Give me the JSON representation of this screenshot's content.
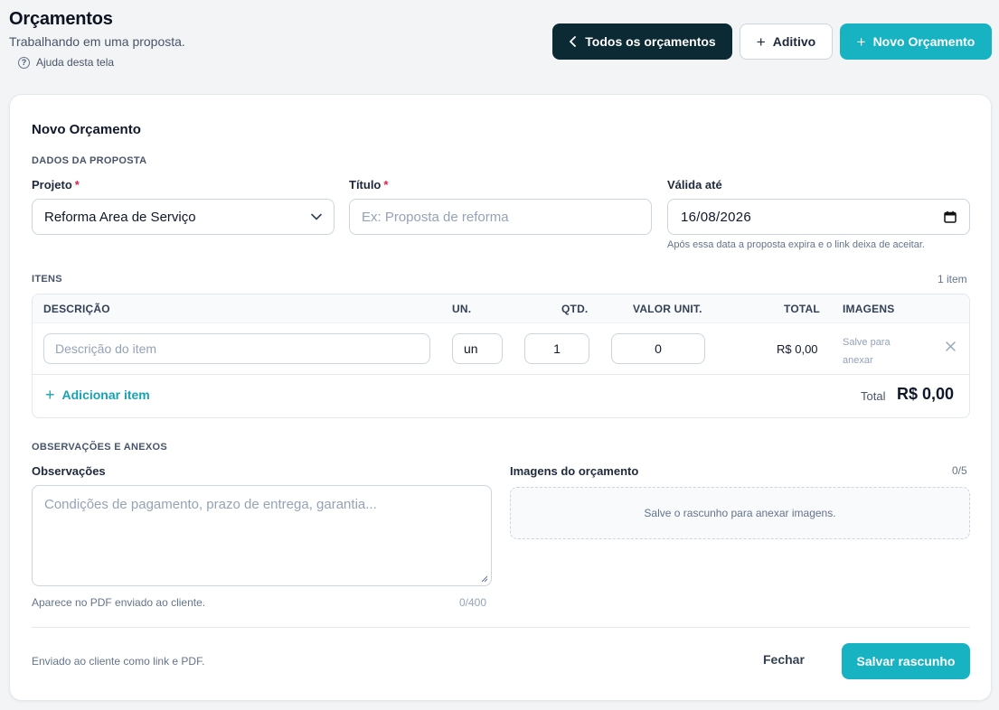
{
  "header": {
    "title": "Orçamentos",
    "subtitle": "Trabalhando em uma proposta.",
    "help_label": "Ajuda desta tela"
  },
  "actions": {
    "all_label": "Todos os orçamentos",
    "addendum_label": "Aditivo",
    "new_label": "Novo Orçamento"
  },
  "form": {
    "title": "Novo Orçamento",
    "proposal_section": "DADOS DA PROPOSTA",
    "project_label": "Projeto",
    "project_value": "Reforma Area de Serviço",
    "title_label": "Título",
    "title_placeholder": "Ex: Proposta de reforma",
    "valid_label": "Válida até",
    "valid_value": "16/08/2026",
    "valid_help": "Após essa data a proposta expira e o link deixa de aceitar.",
    "required_mark": "*"
  },
  "items": {
    "section": "ITENS",
    "count": "1 item",
    "columns": {
      "description": "DESCRIÇÃO",
      "unit": "UN.",
      "qty": "QTD.",
      "unit_value": "VALOR UNIT.",
      "total": "TOTAL",
      "images": "IMAGENS"
    },
    "rows": [
      {
        "description_placeholder": "Descrição do item",
        "unit": "un",
        "qty": "1",
        "unit_value": "0",
        "total": "R$ 0,00",
        "images_note": "Salve para anexar"
      }
    ],
    "add_label": "Adicionar item",
    "total_label": "Total",
    "total_value": "R$ 0,00"
  },
  "notes": {
    "section": "OBSERVAÇÕES E ANEXOS",
    "obs_label": "Observações",
    "obs_placeholder": "Condições de pagamento, prazo de entrega, garantia...",
    "obs_help": "Aparece no PDF enviado ao cliente.",
    "obs_counter": "0/400",
    "images_label": "Imagens do orçamento",
    "images_counter": "0/5",
    "images_drop": "Salve o rascunho para anexar imagens."
  },
  "footer": {
    "note": "Enviado ao cliente como link e PDF.",
    "close_label": "Fechar",
    "save_label": "Salvar rascunho"
  },
  "icons": {
    "back": "chevron-left-icon",
    "plus": "plus-icon",
    "help": "question-circle-icon",
    "chevron_down": "chevron-down-icon",
    "calendar": "calendar-icon",
    "remove": "close-icon"
  },
  "colors": {
    "primary": "#17b3c3",
    "dark": "#0c2a33",
    "required": "#e11d48"
  }
}
